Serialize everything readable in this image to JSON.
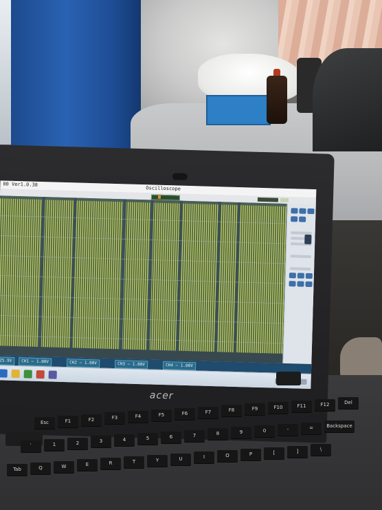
{
  "app": {
    "version_label": "00 Ver1.0.38",
    "window_title": "Oscilloscope"
  },
  "laptop": {
    "brand": "acer"
  },
  "channels": [
    {
      "label": "CH1 — 1.00V"
    },
    {
      "label": "CH2 — 1.00V"
    },
    {
      "label": "CH3 — 1.00V"
    },
    {
      "label": "CH4 — 1.00V"
    }
  ],
  "status": {
    "left_value": "25.9V"
  },
  "colors": {
    "trace": "#d6e04e",
    "plot_bg": "#4a5f56",
    "grid": "#9db1a8",
    "channel_bar": "#1e4b6e"
  },
  "keyboard": {
    "rows": [
      [
        "Esc",
        "F1",
        "F2",
        "F3",
        "F4",
        "F5",
        "F6",
        "F7",
        "F8",
        "F9",
        "F10",
        "F11",
        "F12",
        "Del"
      ],
      [
        "`",
        "1",
        "2",
        "3",
        "4",
        "5",
        "6",
        "7",
        "8",
        "9",
        "0",
        "-",
        "=",
        "Backspace"
      ],
      [
        "Tab",
        "Q",
        "W",
        "E",
        "R",
        "T",
        "Y",
        "U",
        "I",
        "O",
        "P",
        "[",
        "]",
        "\\"
      ]
    ]
  }
}
